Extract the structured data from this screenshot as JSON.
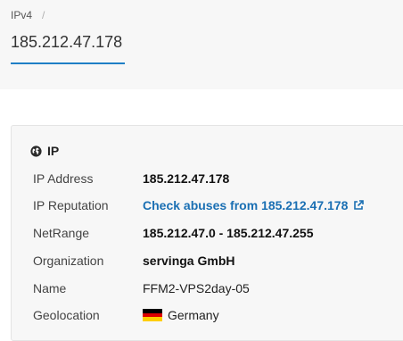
{
  "breadcrumb": {
    "item": "IPv4",
    "separator": "/"
  },
  "tab": {
    "label": "185.212.47.178"
  },
  "section": {
    "title": "IP",
    "icon": "globe-icon"
  },
  "rows": [
    {
      "label": "IP Address",
      "value": "185.212.47.178"
    },
    {
      "label": "IP Reputation",
      "value": "Check abuses from 185.212.47.178",
      "icon": "external-link-icon"
    },
    {
      "label": "NetRange",
      "value": "185.212.47.0 - 185.212.47.255"
    },
    {
      "label": "Organization",
      "value": "servinga GmbH"
    },
    {
      "label": "Name",
      "value": "FFM2-VPS2day-05"
    },
    {
      "label": "Geolocation",
      "value": "Germany",
      "icon": "germany-flag-icon"
    }
  ],
  "colors": {
    "accent": "#1f7fc6",
    "link": "#1a6fb3",
    "flag_black": "#000000",
    "flag_red": "#dd0000",
    "flag_gold": "#ffce00"
  }
}
